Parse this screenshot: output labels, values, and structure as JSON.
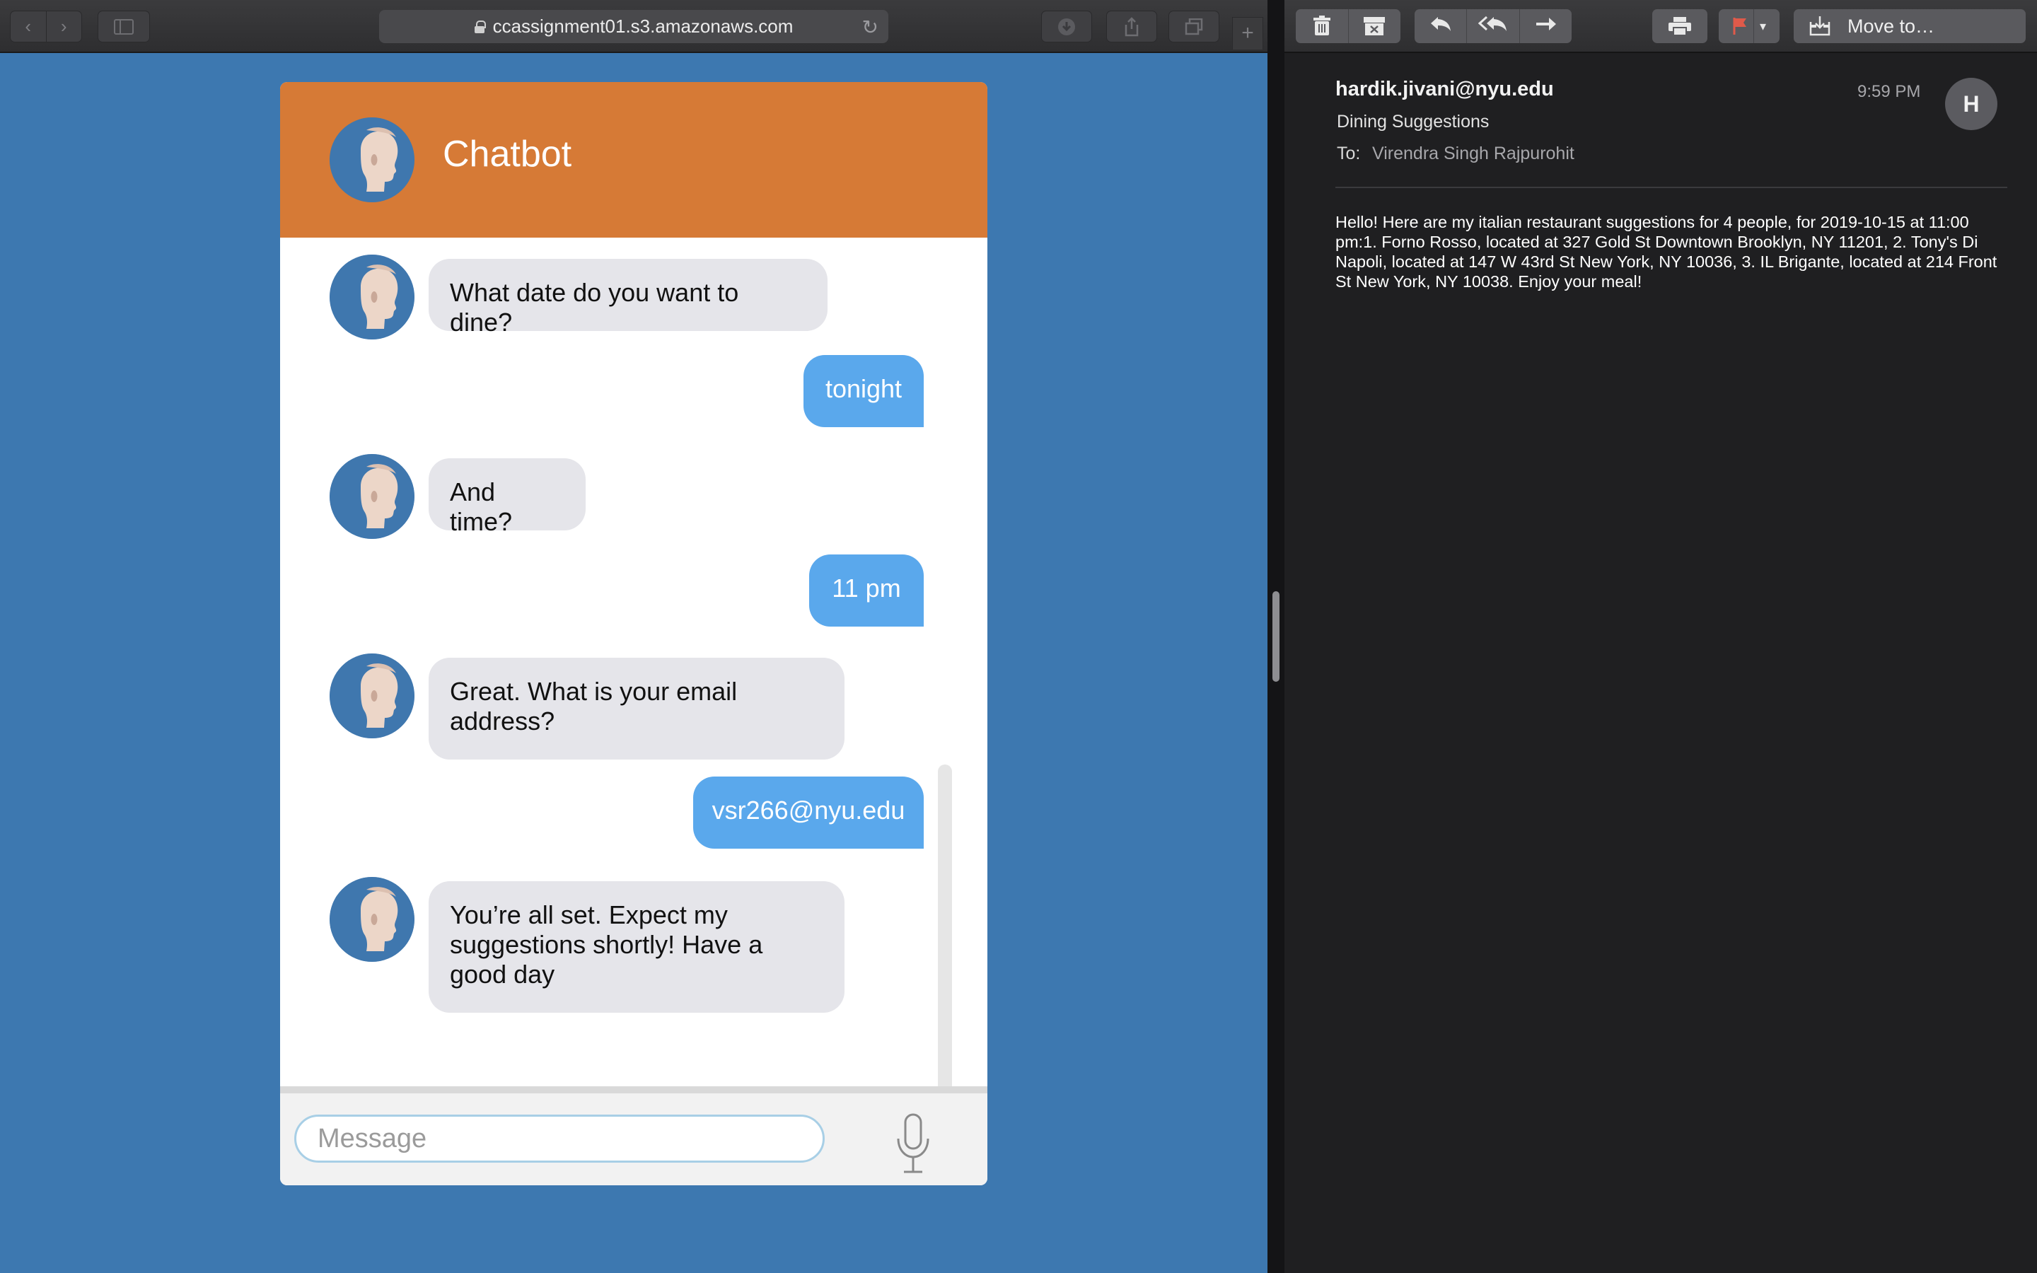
{
  "browser": {
    "url": "ccassignment01.s3.amazonaws.com",
    "icons": [
      "back-icon",
      "forward-icon",
      "sidebar-icon",
      "lock-icon",
      "reload-icon",
      "download-icon",
      "share-icon",
      "tabs-icon",
      "new-tab-icon"
    ]
  },
  "chatbot": {
    "title": "Chatbot",
    "messages": [
      {
        "sender": "bot",
        "text": "What date do you want to dine?"
      },
      {
        "sender": "user",
        "text": "tonight"
      },
      {
        "sender": "bot",
        "text": "And time?"
      },
      {
        "sender": "user",
        "text": "11 pm"
      },
      {
        "sender": "bot",
        "text": "Great. What is your email address?"
      },
      {
        "sender": "user",
        "text": "vsr266@nyu.edu"
      },
      {
        "sender": "bot",
        "text": "You’re all set. Expect my suggestions shortly! Have a good day"
      }
    ],
    "input_placeholder": "Message",
    "colors": {
      "header": "#d67a36",
      "page_background": "#3d78b0",
      "bot_bubble": "#e5e5ea",
      "user_bubble": "#5aa8ec"
    }
  },
  "mail": {
    "toolbar": {
      "move_to_label": "Move to…",
      "icons": [
        "trash-icon",
        "archive-icon",
        "reply-icon",
        "reply-all-icon",
        "forward-icon",
        "print-icon",
        "flag-icon",
        "chevron-down-icon",
        "move-icon"
      ]
    },
    "message": {
      "from": "hardik.jivani@nyu.edu",
      "subject": "Dining Suggestions",
      "to_label": "To:",
      "to": "Virendra Singh Rajpurohit",
      "time": "9:59 PM",
      "avatar_letter": "H",
      "body": "Hello! Here are my italian restaurant suggestions for 4 people, for 2019-10-15 at 11:00 pm:1. Forno Rosso, located at 327 Gold St Downtown Brooklyn, NY 11201, 2. Tony's Di Napoli, located at 147 W 43rd St New York, NY 10036, 3. IL Brigante, located at 214 Front St New York, NY 10038. Enjoy your meal!"
    }
  }
}
